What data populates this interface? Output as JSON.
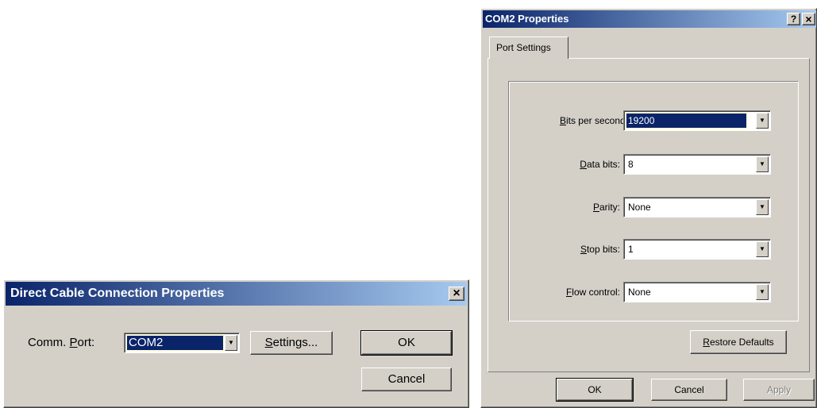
{
  "direct_cable": {
    "title": "Direct Cable Connection Properties",
    "close_label": "×",
    "comm_port": {
      "label_prefix": "Comm. ",
      "label_accel": "P",
      "label_suffix": "ort:",
      "value": "COM2"
    },
    "settings_button": {
      "accel": "S",
      "rest": "ettings..."
    },
    "ok_label": "OK",
    "cancel_label": "Cancel"
  },
  "com_props": {
    "title": "COM2 Properties",
    "help_label": "?",
    "close_label": "×",
    "tab_label": "Port Settings",
    "fields": {
      "bits": {
        "accel": "B",
        "rest": "its per second:",
        "value": "19200"
      },
      "data": {
        "accel": "D",
        "rest": "ata bits:",
        "value": "8"
      },
      "parity": {
        "accel": "P",
        "rest": "arity:",
        "value": "None"
      },
      "stop": {
        "accel": "S",
        "rest": "top bits:",
        "value": "1"
      },
      "flow": {
        "accel": "F",
        "rest": "low control:",
        "value": "None"
      }
    },
    "restore_button": {
      "accel": "R",
      "rest": "estore Defaults"
    },
    "ok_label": "OK",
    "cancel_label": "Cancel",
    "apply_label": "Apply"
  },
  "colors": {
    "title_start": "#0a246a",
    "title_end": "#a6caf0",
    "face": "#d4d0c8"
  },
  "icons": {
    "dropdown": "chevron-down-icon",
    "close": "close-icon",
    "help": "help-icon"
  }
}
